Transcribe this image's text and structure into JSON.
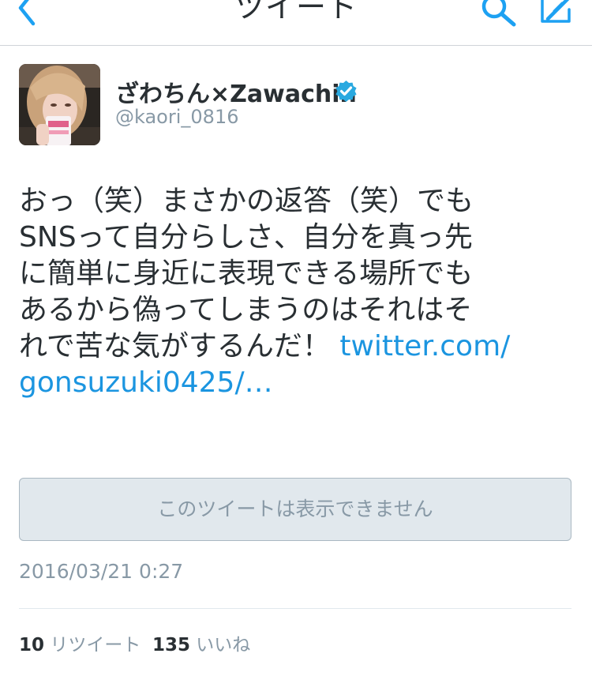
{
  "nav": {
    "title": "ツイート",
    "back_icon": "chevron-left-icon",
    "search_icon": "search-icon",
    "compose_icon": "compose-icon",
    "accent": "#1da1f2"
  },
  "tweet": {
    "author": {
      "display_name": "ざわちん×Zawachin",
      "handle": "@kaori_0816",
      "verified": true
    },
    "text_lines": [
      "おっ（笑）まさかの返答（笑）でも",
      "SNSって自分らしさ、自分を真っ先",
      "に簡単に身近に表現できる場所でも",
      "あるから偽ってしまうのはそれはそ"
    ],
    "text_line5": "れで苦な気がするんだ！",
    "link_part1": "twitter.com/",
    "link_part2": "gonsuzuki0425/…",
    "link_color": "#1b95e0",
    "unavailable_notice": "このツイートは表示できません",
    "timestamp": "2016/03/21 0:27",
    "stats": {
      "retweets_count": "10",
      "retweets_label": "リツイート",
      "likes_count": "135",
      "likes_label": "いいね"
    }
  }
}
